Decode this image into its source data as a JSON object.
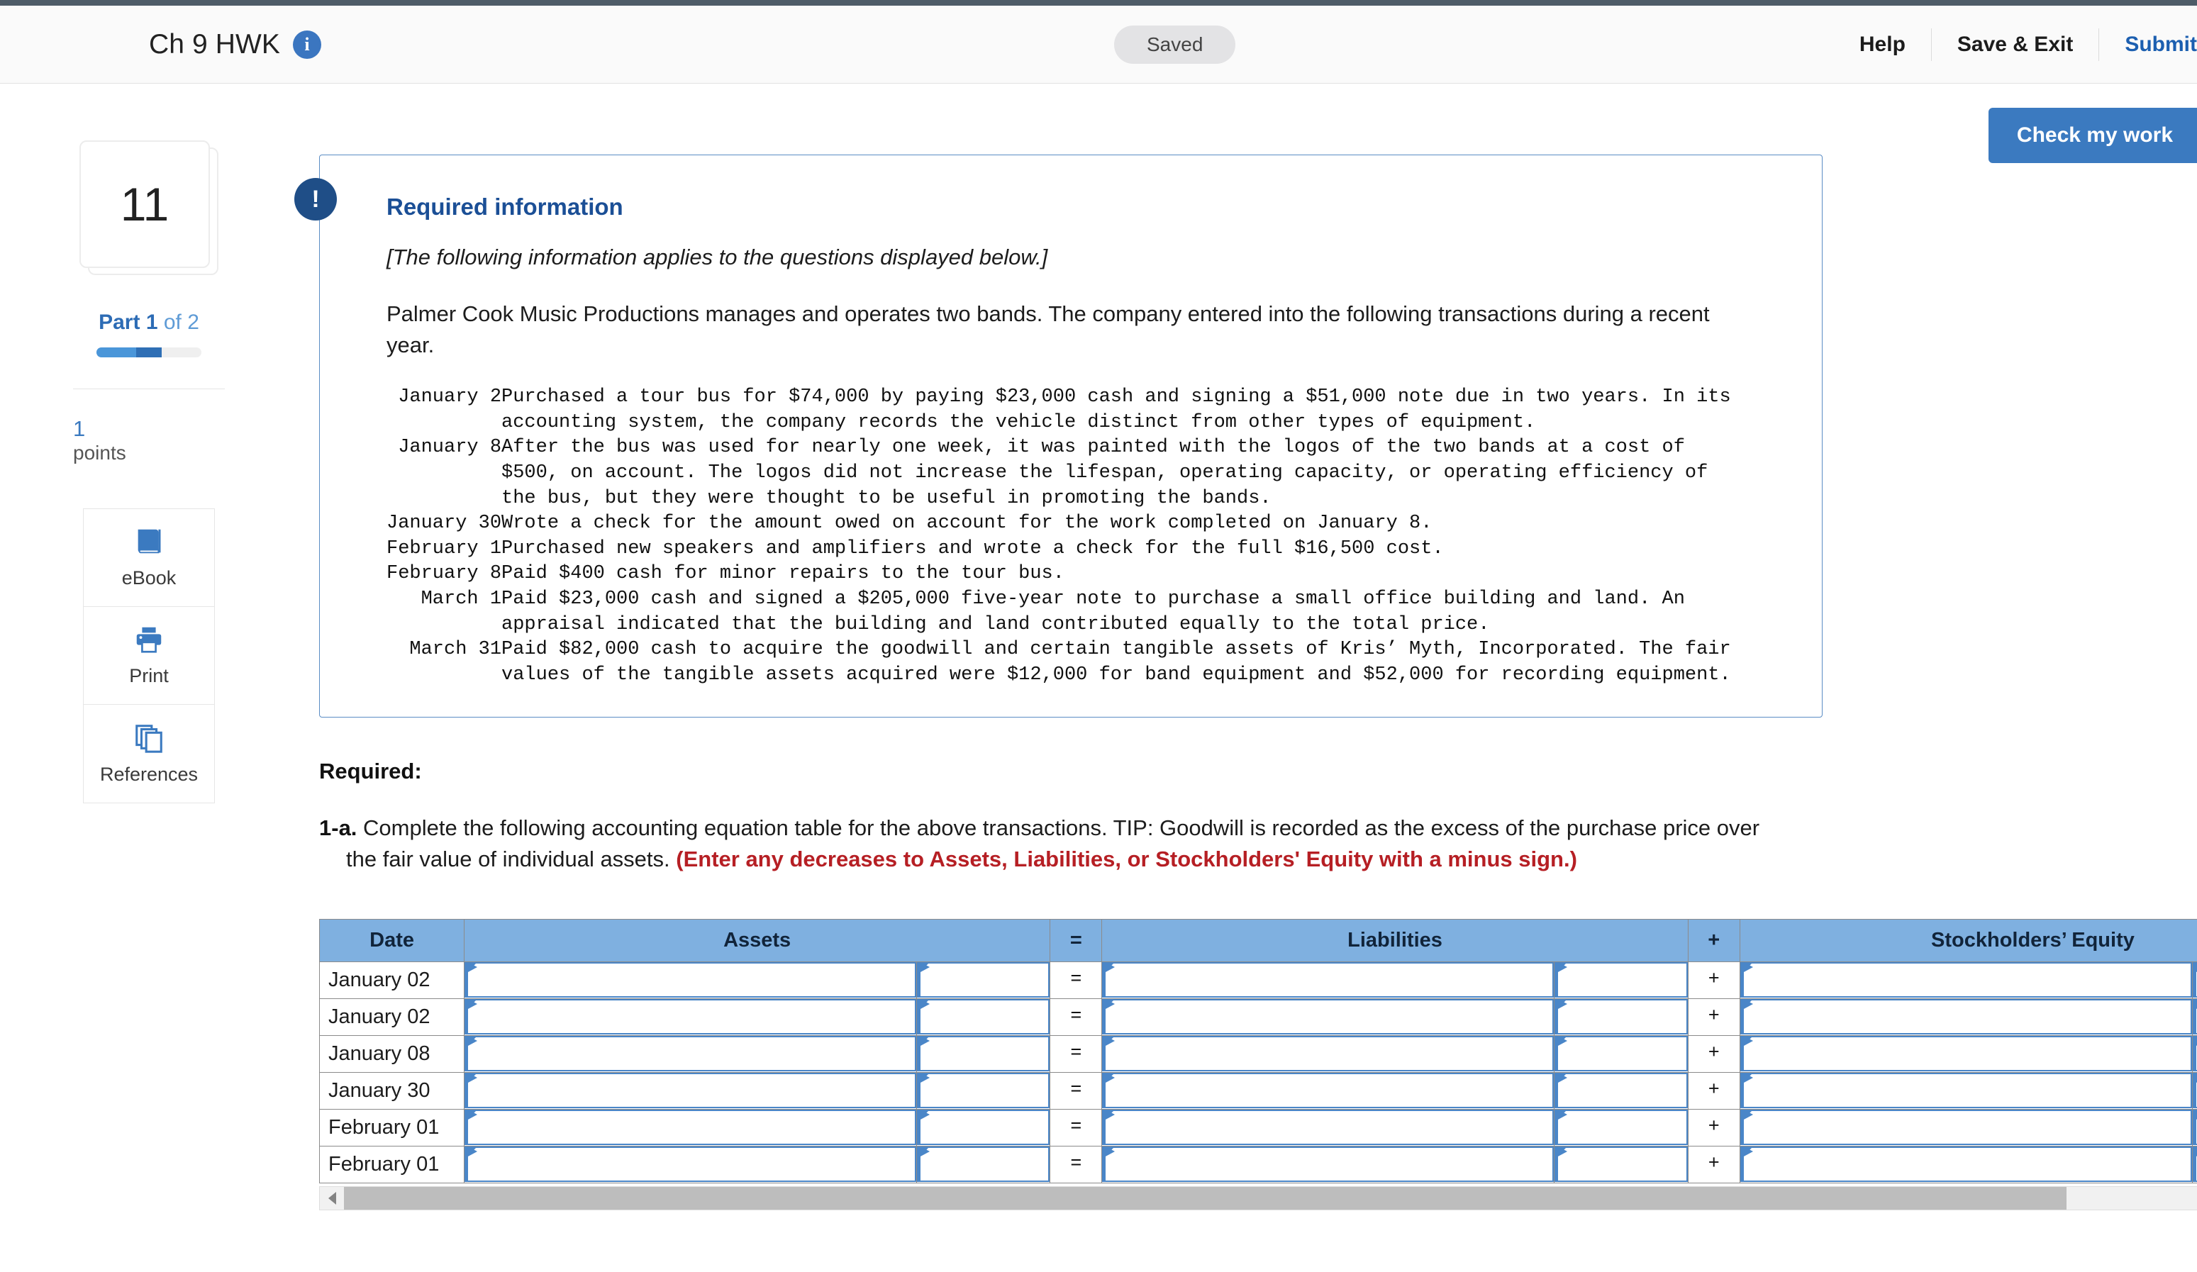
{
  "header": {
    "title": "Ch 9 HWK",
    "info_icon": "info-icon",
    "status_badge": "Saved",
    "help_label": "Help",
    "save_exit_label": "Save & Exit",
    "submit_label": "Submit"
  },
  "actions": {
    "check_my_work_label": "Check my work"
  },
  "sidebar": {
    "question_number": "11",
    "part_prefix": "Part",
    "part_current": "1",
    "part_of": "of 2",
    "points_value": "1",
    "points_label": "points",
    "tools": [
      {
        "label": "eBook",
        "icon": "book-icon"
      },
      {
        "label": "Print",
        "icon": "printer-icon"
      },
      {
        "label": "References",
        "icon": "pages-stack-icon"
      }
    ]
  },
  "required_info": {
    "bang_icon": "exclamation-icon",
    "title": "Required information",
    "applies_note": "[The following information applies to the questions displayed below.]",
    "intro": "Palmer Cook Music Productions manages and operates two bands. The company entered into the following transactions during a recent year.",
    "transactions": [
      {
        "date": "January 2",
        "description": "Purchased a tour bus for $74,000 by paying $23,000 cash and signing a $51,000 note due in two years. In its\naccounting system, the company records the vehicle distinct from other types of equipment."
      },
      {
        "date": "January 8",
        "description": "After the bus was used for nearly one week, it was painted with the logos of the two bands at a cost of\n$500, on account. The logos did not increase the lifespan, operating capacity, or operating efficiency of\nthe bus, but they were thought to be useful in promoting the bands."
      },
      {
        "date": "January 30",
        "description": "Wrote a check for the amount owed on account for the work completed on January 8."
      },
      {
        "date": "February 1",
        "description": "Purchased new speakers and amplifiers and wrote a check for the full $16,500 cost."
      },
      {
        "date": "February 8",
        "description": "Paid $400 cash for minor repairs to the tour bus."
      },
      {
        "date": "March 1",
        "description": "Paid $23,000 cash and signed a $205,000 five-year note to purchase a small office building and land. An\nappraisal indicated that the building and land contributed equally to the total price."
      },
      {
        "date": "March 31",
        "description": "Paid $82,000 cash to acquire the goodwill and certain tangible assets of Kris’ Myth, Incorporated. The fair\nvalues of the tangible assets acquired were $12,000 for band equipment and $52,000 for recording equipment."
      }
    ]
  },
  "required_section": {
    "heading": "Required:",
    "item_number": "1-a.",
    "item_text": "Complete the following accounting equation table for the above transactions. TIP: Goodwill is recorded as the excess of the purchase price over the fair value of individual assets. ",
    "item_warning": "(Enter any decreases to Assets, Liabilities, or Stockholders' Equity with a minus sign.)"
  },
  "answer_table": {
    "columns": [
      "Date",
      "Assets",
      "",
      "=",
      "Liabilities",
      "",
      "+",
      "Stockholders’ Equity",
      ""
    ],
    "headers": {
      "date": "Date",
      "assets": "Assets",
      "equals": "=",
      "liabilities": "Liabilities",
      "plus": "+",
      "equity": "Stockholders’ Equity"
    },
    "rows": [
      {
        "date": "January 02",
        "equals": "=",
        "plus": "+"
      },
      {
        "date": "January 02",
        "equals": "=",
        "plus": "+"
      },
      {
        "date": "January 08",
        "equals": "=",
        "plus": "+"
      },
      {
        "date": "January 30",
        "equals": "=",
        "plus": "+"
      },
      {
        "date": "February 01",
        "equals": "=",
        "plus": "+"
      },
      {
        "date": "February 01",
        "equals": "=",
        "plus": "+"
      }
    ]
  },
  "colors": {
    "accent_blue": "#3b7ac0",
    "header_blue": "#7fb0e0",
    "panel_border": "#5a8cc4",
    "warning_red": "#b61f24",
    "input_border": "#4a86c8",
    "topstrip": "#4e5c68"
  }
}
